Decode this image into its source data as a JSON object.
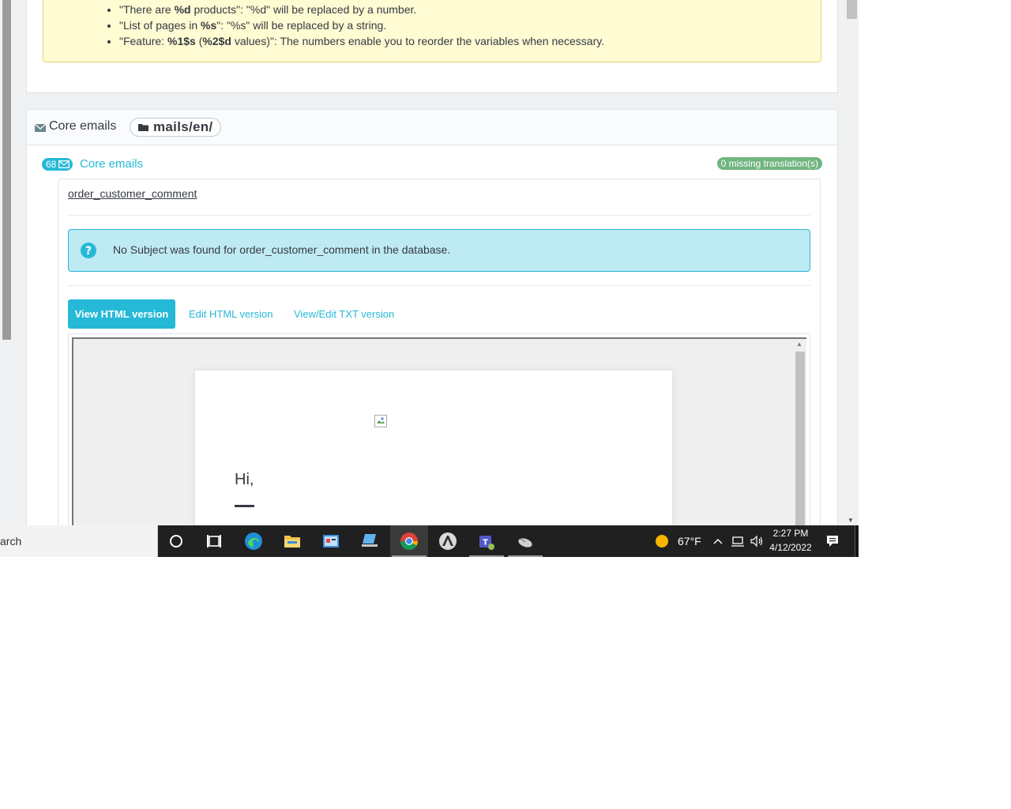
{
  "alert": {
    "items": [
      {
        "q1": "\"There are ",
        "b1": "%d",
        "t1": " products\": \"%d\" will be replaced by a number.",
        "b2": "",
        "t2": "",
        "b3": "",
        "t3": ""
      },
      {
        "q1": "\"List of pages in ",
        "b1": "%s",
        "t1": "\": \"%s\" will be replaced by a string.",
        "b2": "",
        "t2": "",
        "b3": "",
        "t3": ""
      },
      {
        "q1": "\"Feature: ",
        "b1": "%1$s",
        "t1": " (",
        "b2": "%2$d",
        "t2": " values)\": The numbers enable you to reorder the variables when necessary.",
        "b3": "",
        "t3": ""
      }
    ]
  },
  "core": {
    "title": "Core emails",
    "path": "mails/en/",
    "count": "68",
    "link_label": "Core emails",
    "missing": "0 missing translation(s)"
  },
  "mail": {
    "name": "order_customer_comment",
    "info": "No Subject was found for order_customer_comment in the database.",
    "tabs": {
      "view_html": "View HTML version",
      "edit_html": "Edit HTML version",
      "view_txt": "View/Edit TXT version"
    },
    "preview": {
      "greeting": "Hi,"
    }
  },
  "taskbar": {
    "search_text": "arch",
    "weather": "67°F",
    "time": "2:27 PM",
    "date": "4/12/2022"
  },
  "colors": {
    "accent": "#25b9d7",
    "success": "#70b580",
    "alert_warning_bg": "#fffbd3",
    "alert_info_bg": "#beeaf3"
  }
}
